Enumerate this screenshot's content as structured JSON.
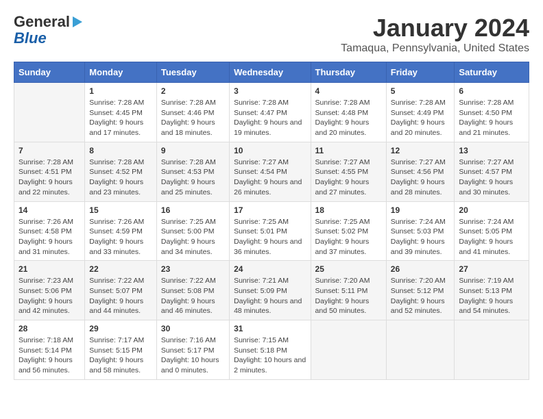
{
  "header": {
    "logo_general": "General",
    "logo_blue": "Blue",
    "title": "January 2024",
    "subtitle": "Tamaqua, Pennsylvania, United States"
  },
  "weekdays": [
    "Sunday",
    "Monday",
    "Tuesday",
    "Wednesday",
    "Thursday",
    "Friday",
    "Saturday"
  ],
  "weeks": [
    [
      {
        "day": "",
        "sunrise": "",
        "sunset": "",
        "daylight": ""
      },
      {
        "day": "1",
        "sunrise": "Sunrise: 7:28 AM",
        "sunset": "Sunset: 4:45 PM",
        "daylight": "Daylight: 9 hours and 17 minutes."
      },
      {
        "day": "2",
        "sunrise": "Sunrise: 7:28 AM",
        "sunset": "Sunset: 4:46 PM",
        "daylight": "Daylight: 9 hours and 18 minutes."
      },
      {
        "day": "3",
        "sunrise": "Sunrise: 7:28 AM",
        "sunset": "Sunset: 4:47 PM",
        "daylight": "Daylight: 9 hours and 19 minutes."
      },
      {
        "day": "4",
        "sunrise": "Sunrise: 7:28 AM",
        "sunset": "Sunset: 4:48 PM",
        "daylight": "Daylight: 9 hours and 20 minutes."
      },
      {
        "day": "5",
        "sunrise": "Sunrise: 7:28 AM",
        "sunset": "Sunset: 4:49 PM",
        "daylight": "Daylight: 9 hours and 20 minutes."
      },
      {
        "day": "6",
        "sunrise": "Sunrise: 7:28 AM",
        "sunset": "Sunset: 4:50 PM",
        "daylight": "Daylight: 9 hours and 21 minutes."
      }
    ],
    [
      {
        "day": "7",
        "sunrise": "Sunrise: 7:28 AM",
        "sunset": "Sunset: 4:51 PM",
        "daylight": "Daylight: 9 hours and 22 minutes."
      },
      {
        "day": "8",
        "sunrise": "Sunrise: 7:28 AM",
        "sunset": "Sunset: 4:52 PM",
        "daylight": "Daylight: 9 hours and 23 minutes."
      },
      {
        "day": "9",
        "sunrise": "Sunrise: 7:28 AM",
        "sunset": "Sunset: 4:53 PM",
        "daylight": "Daylight: 9 hours and 25 minutes."
      },
      {
        "day": "10",
        "sunrise": "Sunrise: 7:27 AM",
        "sunset": "Sunset: 4:54 PM",
        "daylight": "Daylight: 9 hours and 26 minutes."
      },
      {
        "day": "11",
        "sunrise": "Sunrise: 7:27 AM",
        "sunset": "Sunset: 4:55 PM",
        "daylight": "Daylight: 9 hours and 27 minutes."
      },
      {
        "day": "12",
        "sunrise": "Sunrise: 7:27 AM",
        "sunset": "Sunset: 4:56 PM",
        "daylight": "Daylight: 9 hours and 28 minutes."
      },
      {
        "day": "13",
        "sunrise": "Sunrise: 7:27 AM",
        "sunset": "Sunset: 4:57 PM",
        "daylight": "Daylight: 9 hours and 30 minutes."
      }
    ],
    [
      {
        "day": "14",
        "sunrise": "Sunrise: 7:26 AM",
        "sunset": "Sunset: 4:58 PM",
        "daylight": "Daylight: 9 hours and 31 minutes."
      },
      {
        "day": "15",
        "sunrise": "Sunrise: 7:26 AM",
        "sunset": "Sunset: 4:59 PM",
        "daylight": "Daylight: 9 hours and 33 minutes."
      },
      {
        "day": "16",
        "sunrise": "Sunrise: 7:25 AM",
        "sunset": "Sunset: 5:00 PM",
        "daylight": "Daylight: 9 hours and 34 minutes."
      },
      {
        "day": "17",
        "sunrise": "Sunrise: 7:25 AM",
        "sunset": "Sunset: 5:01 PM",
        "daylight": "Daylight: 9 hours and 36 minutes."
      },
      {
        "day": "18",
        "sunrise": "Sunrise: 7:25 AM",
        "sunset": "Sunset: 5:02 PM",
        "daylight": "Daylight: 9 hours and 37 minutes."
      },
      {
        "day": "19",
        "sunrise": "Sunrise: 7:24 AM",
        "sunset": "Sunset: 5:03 PM",
        "daylight": "Daylight: 9 hours and 39 minutes."
      },
      {
        "day": "20",
        "sunrise": "Sunrise: 7:24 AM",
        "sunset": "Sunset: 5:05 PM",
        "daylight": "Daylight: 9 hours and 41 minutes."
      }
    ],
    [
      {
        "day": "21",
        "sunrise": "Sunrise: 7:23 AM",
        "sunset": "Sunset: 5:06 PM",
        "daylight": "Daylight: 9 hours and 42 minutes."
      },
      {
        "day": "22",
        "sunrise": "Sunrise: 7:22 AM",
        "sunset": "Sunset: 5:07 PM",
        "daylight": "Daylight: 9 hours and 44 minutes."
      },
      {
        "day": "23",
        "sunrise": "Sunrise: 7:22 AM",
        "sunset": "Sunset: 5:08 PM",
        "daylight": "Daylight: 9 hours and 46 minutes."
      },
      {
        "day": "24",
        "sunrise": "Sunrise: 7:21 AM",
        "sunset": "Sunset: 5:09 PM",
        "daylight": "Daylight: 9 hours and 48 minutes."
      },
      {
        "day": "25",
        "sunrise": "Sunrise: 7:20 AM",
        "sunset": "Sunset: 5:11 PM",
        "daylight": "Daylight: 9 hours and 50 minutes."
      },
      {
        "day": "26",
        "sunrise": "Sunrise: 7:20 AM",
        "sunset": "Sunset: 5:12 PM",
        "daylight": "Daylight: 9 hours and 52 minutes."
      },
      {
        "day": "27",
        "sunrise": "Sunrise: 7:19 AM",
        "sunset": "Sunset: 5:13 PM",
        "daylight": "Daylight: 9 hours and 54 minutes."
      }
    ],
    [
      {
        "day": "28",
        "sunrise": "Sunrise: 7:18 AM",
        "sunset": "Sunset: 5:14 PM",
        "daylight": "Daylight: 9 hours and 56 minutes."
      },
      {
        "day": "29",
        "sunrise": "Sunrise: 7:17 AM",
        "sunset": "Sunset: 5:15 PM",
        "daylight": "Daylight: 9 hours and 58 minutes."
      },
      {
        "day": "30",
        "sunrise": "Sunrise: 7:16 AM",
        "sunset": "Sunset: 5:17 PM",
        "daylight": "Daylight: 10 hours and 0 minutes."
      },
      {
        "day": "31",
        "sunrise": "Sunrise: 7:15 AM",
        "sunset": "Sunset: 5:18 PM",
        "daylight": "Daylight: 10 hours and 2 minutes."
      },
      {
        "day": "",
        "sunrise": "",
        "sunset": "",
        "daylight": ""
      },
      {
        "day": "",
        "sunrise": "",
        "sunset": "",
        "daylight": ""
      },
      {
        "day": "",
        "sunrise": "",
        "sunset": "",
        "daylight": ""
      }
    ]
  ]
}
